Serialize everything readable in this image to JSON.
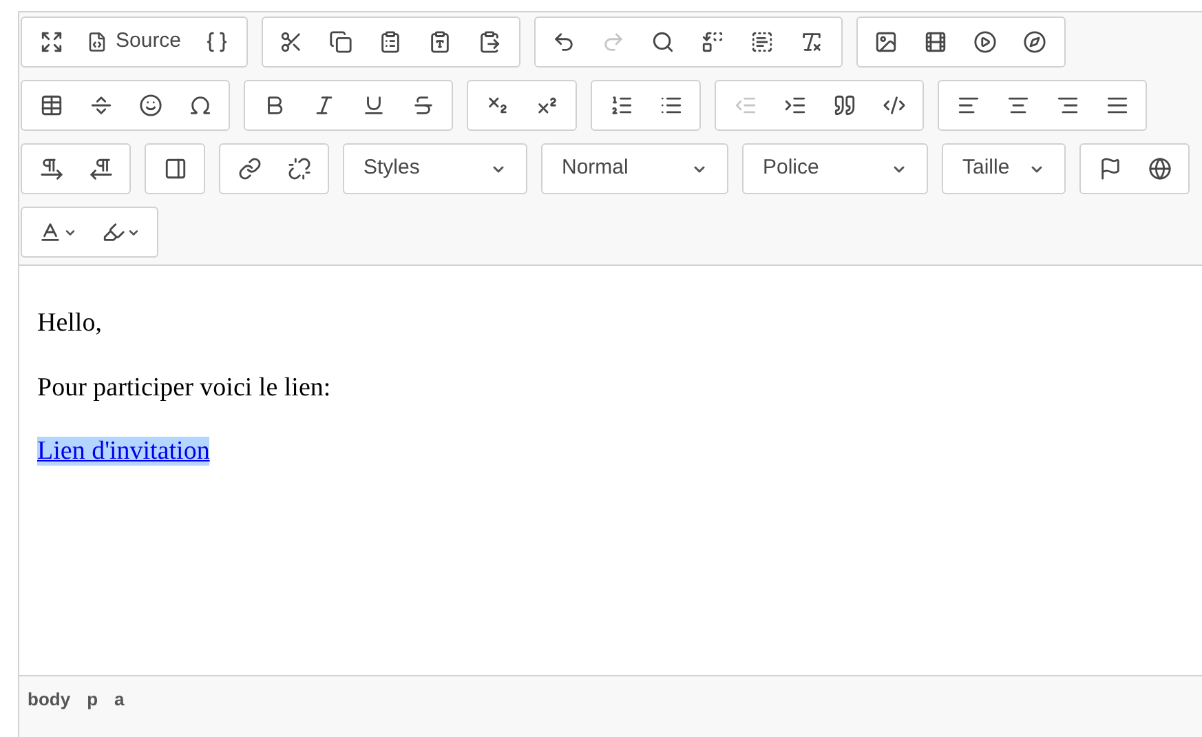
{
  "toolbar": [
    [
      {
        "kind": "icon",
        "disabled": false
      },
      {
        "kind": "icon_text",
        "label": "Source",
        "disabled": false
      },
      {
        "kind": "icon",
        "disabled": false
      }
    ],
    [
      {
        "kind": "icon",
        "disabled": false
      },
      {
        "kind": "icon",
        "disabled": false
      },
      {
        "kind": "icon",
        "disabled": false
      },
      {
        "kind": "icon",
        "disabled": false
      },
      {
        "kind": "icon",
        "disabled": false
      }
    ],
    [
      {
        "kind": "icon",
        "disabled": false
      },
      {
        "kind": "icon",
        "disabled": true
      },
      {
        "kind": "icon",
        "disabled": false
      },
      {
        "kind": "icon",
        "disabled": false
      },
      {
        "kind": "icon",
        "disabled": false
      },
      {
        "kind": "icon",
        "disabled": false
      }
    ],
    [
      {
        "kind": "icon",
        "disabled": false
      },
      {
        "kind": "icon",
        "disabled": false
      },
      {
        "kind": "icon",
        "disabled": false
      },
      {
        "kind": "icon",
        "disabled": false
      }
    ],
    [
      {
        "kind": "icon",
        "disabled": false
      },
      {
        "kind": "icon",
        "disabled": false
      },
      {
        "kind": "icon",
        "disabled": false
      },
      {
        "kind": "icon",
        "disabled": false
      }
    ],
    [
      {
        "kind": "icon",
        "disabled": false
      },
      {
        "kind": "icon",
        "disabled": false
      },
      {
        "kind": "icon",
        "disabled": false
      },
      {
        "kind": "icon",
        "disabled": false
      }
    ],
    [
      {
        "kind": "icon",
        "disabled": false
      },
      {
        "kind": "icon",
        "disabled": false
      }
    ],
    [
      {
        "kind": "icon",
        "disabled": false
      },
      {
        "kind": "icon",
        "disabled": false
      }
    ],
    [
      {
        "kind": "icon",
        "disabled": true
      },
      {
        "kind": "icon",
        "disabled": false
      },
      {
        "kind": "icon",
        "disabled": false
      },
      {
        "kind": "icon",
        "disabled": false
      }
    ],
    [
      {
        "kind": "icon",
        "disabled": false
      },
      {
        "kind": "icon",
        "disabled": false
      },
      {
        "kind": "icon",
        "disabled": false
      },
      {
        "kind": "icon",
        "disabled": false
      }
    ],
    [
      {
        "kind": "icon",
        "disabled": false
      },
      {
        "kind": "icon",
        "disabled": false
      }
    ],
    [
      {
        "kind": "icon",
        "disabled": false
      }
    ],
    [
      {
        "kind": "icon",
        "disabled": false
      },
      {
        "kind": "icon",
        "disabled": false
      }
    ],
    [
      {
        "kind": "combo",
        "label": "Styles"
      }
    ],
    [
      {
        "kind": "combo",
        "label": "Normal"
      }
    ],
    [
      {
        "kind": "combo",
        "label": "Police"
      }
    ],
    [
      {
        "kind": "combo",
        "label": "Taille"
      }
    ],
    [
      {
        "kind": "icon",
        "disabled": false
      },
      {
        "kind": "icon",
        "disabled": false
      }
    ],
    [
      {
        "kind": "icon_caret",
        "disabled": false
      },
      {
        "kind": "icon_caret",
        "disabled": false
      }
    ]
  ],
  "content": [
    {
      "kind": "text",
      "text": "Hello,"
    },
    {
      "kind": "text",
      "text": "Pour participer voici le lien:"
    },
    {
      "kind": "link",
      "text": "Lien d'invitation",
      "selected": true
    }
  ],
  "path": [
    "body",
    "p",
    "a"
  ]
}
